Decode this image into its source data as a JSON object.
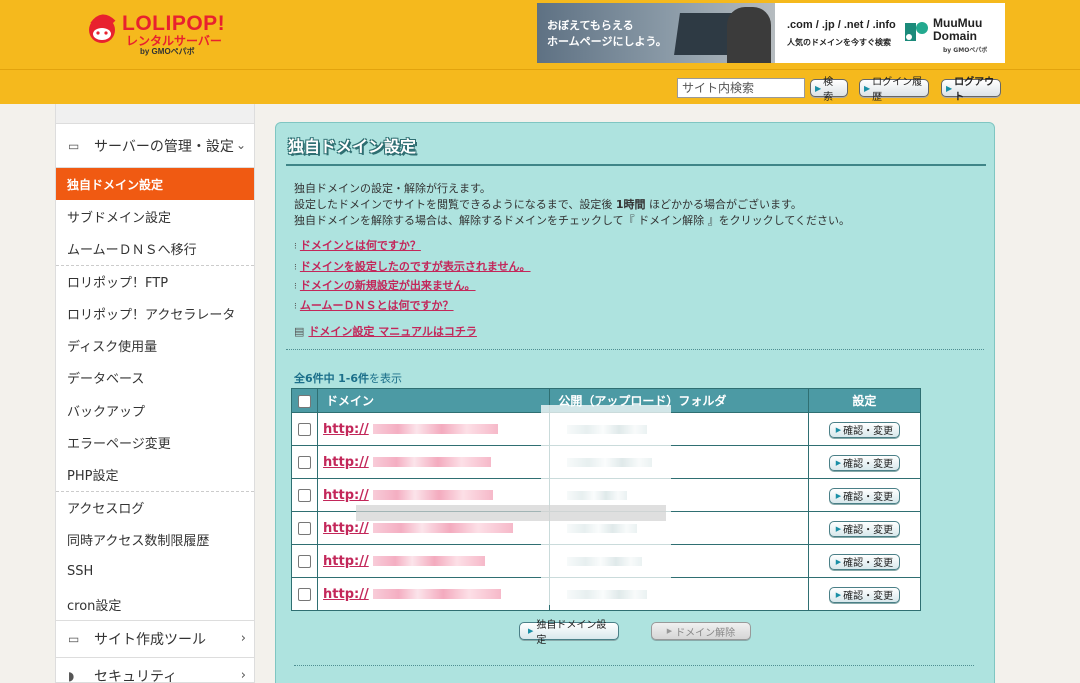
{
  "header": {
    "logo": {
      "text": "LOLIPOP!",
      "sub": "レンタルサーバー",
      "by": "by GMOペパボ"
    },
    "banner": {
      "text_line1": "おぼえてもらえる",
      "text_line2": "ホームページにしよう。",
      "domains": ".com / .jp / .net / .info",
      "domains_sub": "人気のドメインを今すぐ検索",
      "brand_line1": "MuuMuu",
      "brand_line2": "Domain",
      "brand_by": "by GMOペパボ"
    },
    "search": {
      "placeholder": "サイト内検索",
      "button": "検索"
    },
    "login_history": "ログイン履歴",
    "logout": "ログアウト"
  },
  "sidebar": {
    "group_server": "サーバーの管理・設定",
    "items": [
      {
        "label": "独自ドメイン設定",
        "active": true
      },
      {
        "label": "サブドメイン設定"
      },
      {
        "label": "ムームーＤＮＳへ移行"
      },
      {
        "label": "ロリポップ！FTP"
      },
      {
        "label": "ロリポップ！アクセラレータ"
      },
      {
        "label": "ディスク使用量"
      },
      {
        "label": "データベース"
      },
      {
        "label": "バックアップ"
      },
      {
        "label": "エラーページ変更"
      },
      {
        "label": "PHP設定"
      },
      {
        "label": "アクセスログ"
      },
      {
        "label": "同時アクセス数制限履歴"
      },
      {
        "label": "SSH"
      },
      {
        "label": "cron設定"
      }
    ],
    "group_site_tools": "サイト作成ツール",
    "group_security": "セキュリティ"
  },
  "main": {
    "title": "独自ドメイン設定",
    "desc_line1": "独自ドメインの設定・解除が行えます。",
    "desc_line2_pre": "設定したドメインでサイトを閲覧できるようになるまで、設定後",
    "desc_line2_bold": "1時間",
    "desc_line2_post": "ほどかかる場合がございます。",
    "desc_line3": "独自ドメインを解除する場合は、解除するドメインをチェックして『 ドメイン解除 』をクリックしてください。",
    "faq": [
      "ドメインとは何ですか？",
      "ドメインを設定したのですが表示されません。",
      "ドメインの新規設定が出来ません。",
      "ムームーＤＮＳとは何ですか？"
    ],
    "manual": "ドメイン設定 マニュアルはコチラ",
    "count_prefix": "全6件中",
    "count_range": "1-6件",
    "count_suffix": "を表示",
    "table": {
      "headers": {
        "domain": "ドメイン",
        "folder": "公開（アップロード）フォルダ",
        "settings": "設定"
      },
      "rows": [
        {
          "domain": "http://",
          "action": "確認・変更"
        },
        {
          "domain": "http://",
          "action": "確認・変更"
        },
        {
          "domain": "http://",
          "action": "確認・変更"
        },
        {
          "domain": "http://",
          "action": "確認・変更"
        },
        {
          "domain": "http://",
          "action": "確認・変更"
        },
        {
          "domain": "http://",
          "action": "確認・変更"
        }
      ]
    },
    "buttons": {
      "add": "独自ドメイン設定",
      "remove": "ドメイン解除"
    }
  },
  "colors": {
    "header_bg": "#f5b91d",
    "active_item": "#f05a12",
    "panel_bg": "#aee3df",
    "table_header": "#4c9aa4",
    "link": "#c3275a",
    "logo_red": "#e8212e"
  }
}
